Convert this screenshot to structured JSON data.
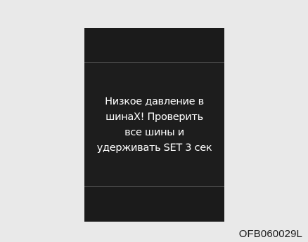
{
  "display": {
    "message_lines": [
      "Низкое давление в",
      "шинаХ! Проверить",
      "все шины и",
      "удерживать SET 3 сек"
    ]
  },
  "figure": {
    "code": "OFB060029L"
  },
  "colors": {
    "page_background": "#ebebeb",
    "display_background": "#1c1c1c",
    "divider": "#5a5a5a",
    "message_text": "#ffffff",
    "caption_text": "#1a1a1a"
  }
}
